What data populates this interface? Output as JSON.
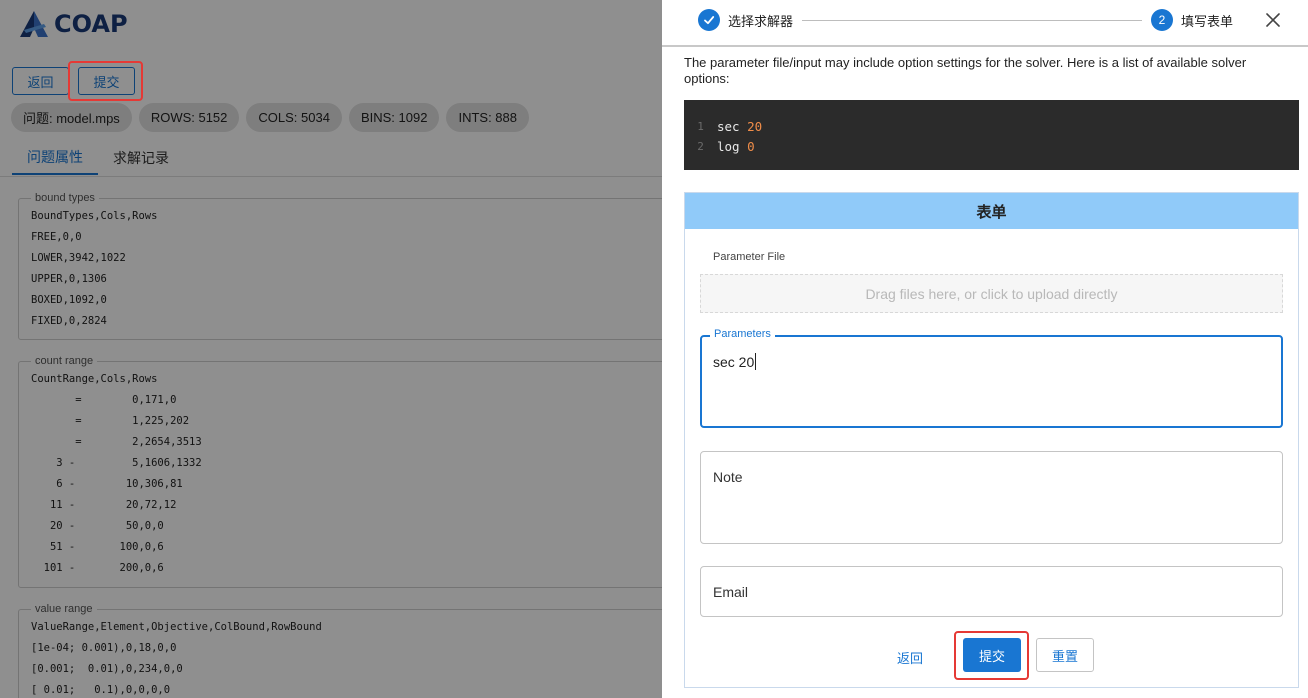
{
  "brand": {
    "logo_text": "COAP",
    "logo_color": "#1a3a78"
  },
  "toolbar": {
    "back_label": "返回",
    "submit_label": "提交"
  },
  "chips": [
    "问题: model.mps",
    "ROWS: 5152",
    "COLS: 5034",
    "BINS: 1092",
    "INTS: 888"
  ],
  "tabs": [
    {
      "label": "问题属性",
      "active": true
    },
    {
      "label": "求解记录",
      "active": false
    }
  ],
  "sections": {
    "bound": {
      "legend": "bound types",
      "lines": [
        "BoundTypes,Cols,Rows",
        "FREE,0,0",
        "LOWER,3942,1022",
        "UPPER,0,1306",
        "BOXED,1092,0",
        "FIXED,0,2824"
      ]
    },
    "count": {
      "legend": "count range",
      "lines": [
        "CountRange,Cols,Rows",
        "       =        0,171,0",
        "       =        1,225,202",
        "       =        2,2654,3513",
        "    3 -         5,1606,1332",
        "    6 -        10,306,81",
        "   11 -        20,72,12",
        "   20 -        50,0,0",
        "   51 -       100,0,6",
        "  101 -       200,0,6"
      ]
    },
    "value": {
      "legend": "value range",
      "lines": [
        "ValueRange,Element,Objective,ColBound,RowBound",
        "[1e-04; 0.001),0,18,0,0",
        "[0.001;  0.01),0,234,0,0",
        "[ 0.01;   0.1),0,0,0,0"
      ]
    }
  },
  "drawer": {
    "steps": [
      {
        "number": "",
        "label": "选择求解器",
        "done": true
      },
      {
        "number": "2",
        "label": "填写表单",
        "done": false
      }
    ],
    "description": "The parameter file/input may include option settings for the solver. Here is a list of available solver options:",
    "code": [
      {
        "ln": "1",
        "key": "sec",
        "value": "20"
      },
      {
        "ln": "2",
        "key": "log",
        "value": "0"
      }
    ],
    "form": {
      "title": "表单",
      "parameter_file_label": "Parameter File",
      "dropzone_text": "Drag files here, or click to upload directly",
      "parameters_label": "Parameters",
      "parameters_value": "sec 20",
      "note_placeholder": "Note",
      "email_placeholder": "Email",
      "back_label": "返回",
      "submit_label": "提交",
      "reset_label": "重置"
    }
  },
  "colors": {
    "primary": "#1976d2",
    "highlight": "#e53935",
    "form_header": "#90caf9",
    "code_bg": "#2b2b2b",
    "code_number": "#f08d49"
  }
}
